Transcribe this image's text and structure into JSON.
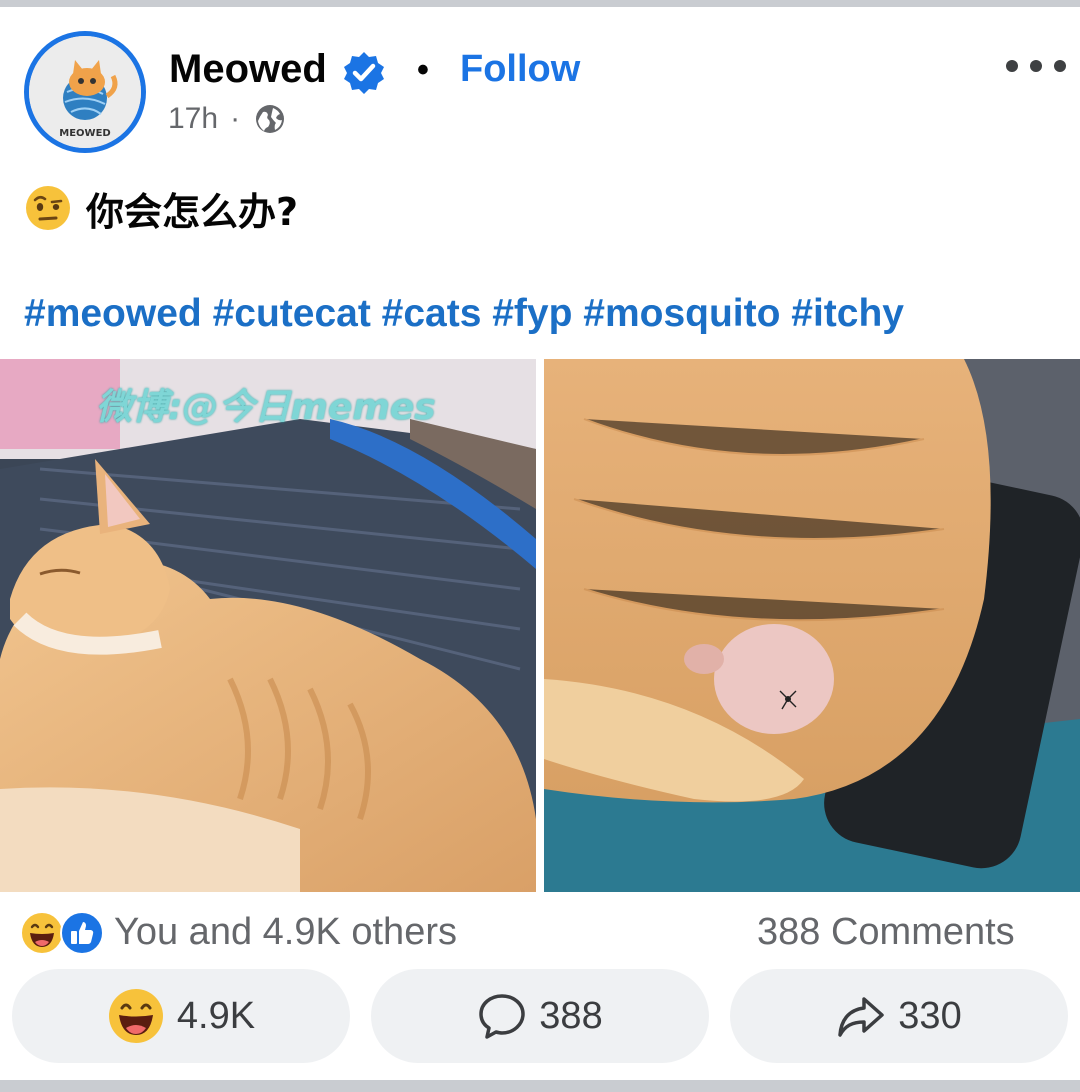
{
  "post": {
    "author": "Meowed",
    "avatar_text": "MEOWED",
    "follow_label": "Follow",
    "separator": "•",
    "time": "17h",
    "meta_separator": "·",
    "caption": "你会怎么办?",
    "hashtags": "#meowed #cutecat #cats #fyp #mosquito #itchy",
    "watermark": "微博:@今日memes"
  },
  "summary": {
    "reactions_text": "You and 4.9K others",
    "comments_text": "388 Comments"
  },
  "actions": {
    "react_count": "4.9K",
    "comment_count": "388",
    "share_count": "330"
  },
  "icons": {
    "verified": "verified-badge-icon",
    "globe": "globe-icon",
    "more": "more-options-icon",
    "caption_emoji": "raised-eyebrow-emoji",
    "haha": "haha-reaction-icon",
    "like": "like-reaction-icon",
    "comment": "comment-bubble-icon",
    "share": "share-arrow-icon"
  },
  "colors": {
    "accent": "#1b74e4",
    "hashtag": "#1b6fc6",
    "secondary_text": "#65676b",
    "button_bg": "#eff1f3"
  }
}
